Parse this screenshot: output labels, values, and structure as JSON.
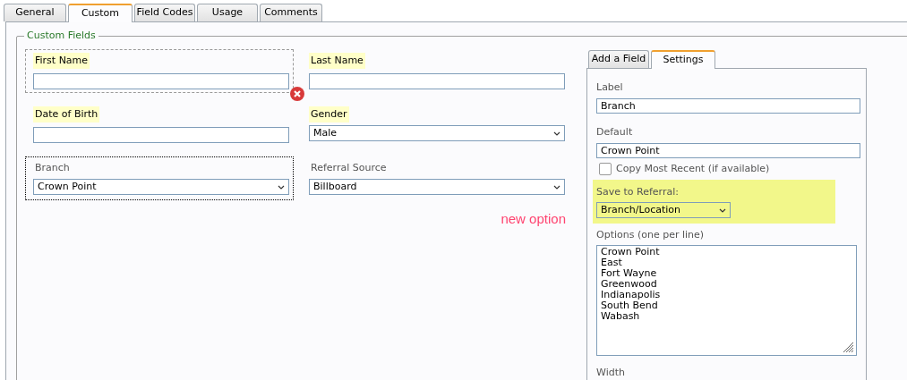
{
  "tabs": [
    {
      "label": "General",
      "selected": false
    },
    {
      "label": "Custom",
      "selected": true
    },
    {
      "label": "Field Codes",
      "selected": false
    },
    {
      "label": "Usage",
      "selected": false
    },
    {
      "label": "Comments",
      "selected": false
    }
  ],
  "fieldset": {
    "legend": "Custom Fields",
    "fields": [
      {
        "label": "First Name",
        "kind": "text",
        "highlighted": true,
        "selected": false,
        "hovered": true
      },
      {
        "label": "Last Name",
        "kind": "text",
        "highlighted": true,
        "selected": false,
        "hovered": false
      },
      {
        "label": "Date of Birth",
        "kind": "text",
        "highlighted": true,
        "selected": false,
        "hovered": false
      },
      {
        "label": "Gender",
        "kind": "select",
        "value": "Male",
        "highlighted": true,
        "selected": false,
        "hovered": false
      },
      {
        "label": "Branch",
        "kind": "select",
        "value": "Crown Point",
        "highlighted": false,
        "selected": true,
        "hovered": false
      },
      {
        "label": "Referral Source",
        "kind": "select",
        "value": "Billboard",
        "highlighted": false,
        "selected": false,
        "hovered": false
      }
    ]
  },
  "annotation": "new option",
  "settings": {
    "tabs": [
      {
        "label": "Add a Field",
        "selected": false
      },
      {
        "label": "Settings",
        "selected": true
      }
    ],
    "label": {
      "caption": "Label",
      "value": "Branch"
    },
    "default": {
      "caption": "Default",
      "value": "Crown Point"
    },
    "copy_most_recent": {
      "label": "Copy Most Recent (if available)",
      "checked": false
    },
    "save_to_referral": {
      "caption": "Save to Referral:",
      "value": "Branch/Location",
      "highlighted": true
    },
    "options": {
      "caption": "Options (one per line)",
      "value": "Crown Point\nEast\nFort Wayne\nGreenwood\nIndianapolis\nSouth Bend\nWabash"
    },
    "width": {
      "caption": "Width"
    }
  }
}
